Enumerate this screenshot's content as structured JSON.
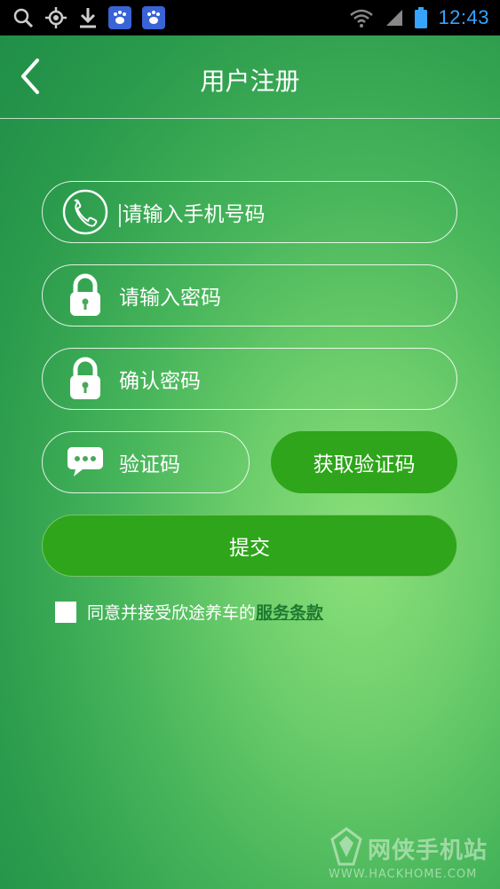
{
  "status_bar": {
    "time": "12:43",
    "icons": [
      "search-icon",
      "gps-icon",
      "download-icon",
      "baidu-paw-icon",
      "baidu-paw-icon",
      "wifi-icon",
      "signal-icon",
      "battery-icon"
    ]
  },
  "header": {
    "title": "用户注册",
    "back_icon": "chevron-left-icon"
  },
  "form": {
    "phone_placeholder": "请输入手机号码",
    "password_placeholder": "请输入密码",
    "confirm_placeholder": "确认密码",
    "code_placeholder": "验证码",
    "get_code_label": "获取验证码",
    "submit_label": "提交"
  },
  "agreement": {
    "text": "同意并接受欣途养车的",
    "link": "服务条款",
    "checked": false
  },
  "watermark": {
    "title": "网侠手机站",
    "url": "WWW.HACKHOME.COM"
  },
  "colors": {
    "button_green": "#2ea51a",
    "link_green": "#1d7a2f",
    "time_blue": "#36a3ff"
  }
}
